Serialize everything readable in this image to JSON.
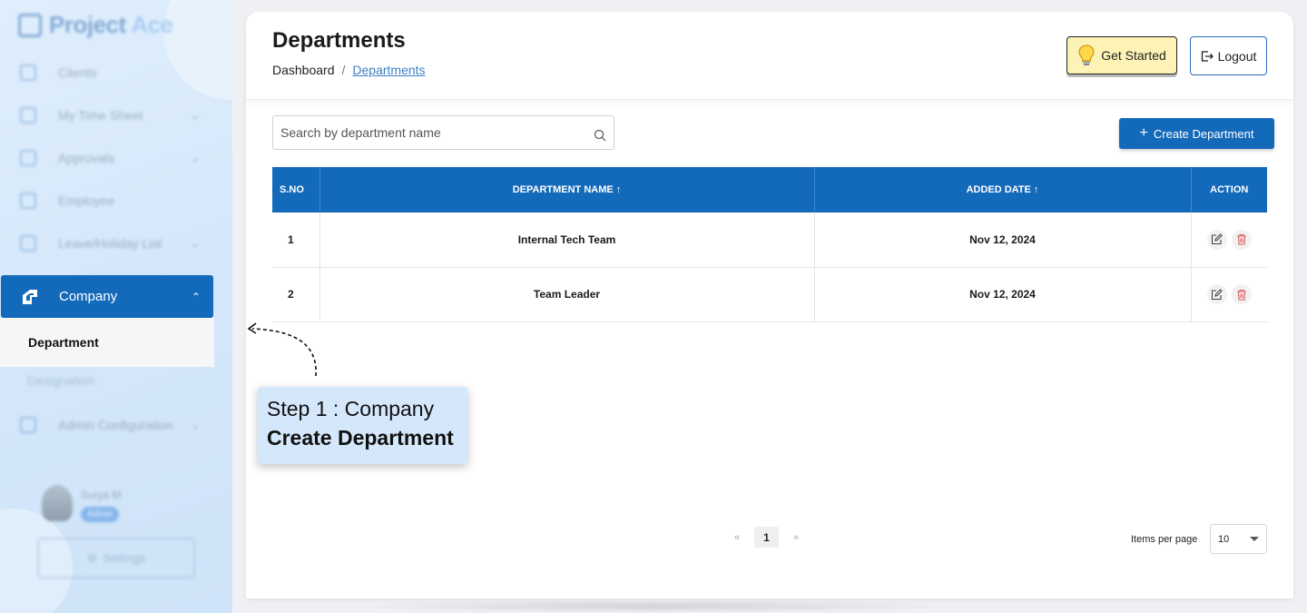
{
  "app": {
    "logo_part1": "Project",
    "logo_part2": "Ace"
  },
  "sidebar": {
    "items": [
      {
        "label": "Clients",
        "icon": "clients-icon",
        "has_chevron": false
      },
      {
        "label": "My Time Sheet",
        "icon": "timesheet-icon",
        "has_chevron": true
      },
      {
        "label": "Approvals",
        "icon": "calendar-icon",
        "has_chevron": true
      },
      {
        "label": "Employee",
        "icon": "employee-icon",
        "has_chevron": false
      },
      {
        "label": "Leave/Holiday List",
        "icon": "leave-icon",
        "has_chevron": true
      }
    ],
    "company": {
      "label": "Company",
      "icon": "company-icon"
    },
    "submenu": {
      "active": "Department",
      "other": "Designation"
    },
    "admin": {
      "label": "Admin Configuration",
      "icon": "admin-config-icon"
    },
    "user": {
      "name": "Surya M",
      "role": "Admin"
    },
    "settings_label": "Settings"
  },
  "header": {
    "title": "Departments",
    "breadcrumb": {
      "home": "Dashboard",
      "separator": "/",
      "current": "Departments"
    },
    "get_started_label": "Get Started",
    "logout_label": "Logout"
  },
  "toolbar": {
    "search_placeholder": "Search by department name",
    "create_label": "Create Department"
  },
  "table": {
    "headers": {
      "sno": "S.NO",
      "name": "DEPARTMENT NAME ↑",
      "date": "ADDED DATE ↑",
      "action": "ACTION"
    },
    "rows": [
      {
        "sno": "1",
        "name": "Internal Tech Team",
        "date": "Nov 12, 2024"
      },
      {
        "sno": "2",
        "name": "Team Leader",
        "date": "Nov 12, 2024"
      }
    ]
  },
  "pagination": {
    "prev": "«",
    "current": "1",
    "next": "»",
    "items_per_page_label": "Items per page",
    "items_per_page": "10"
  },
  "tour": {
    "step": "Step 1  : Company",
    "title": "Create Department"
  },
  "colors": {
    "primary": "#146aba",
    "get_started_bg": "#fdf3b6",
    "tour_bg": "#d5e8fb",
    "delete_icon": "#e05a5a"
  }
}
